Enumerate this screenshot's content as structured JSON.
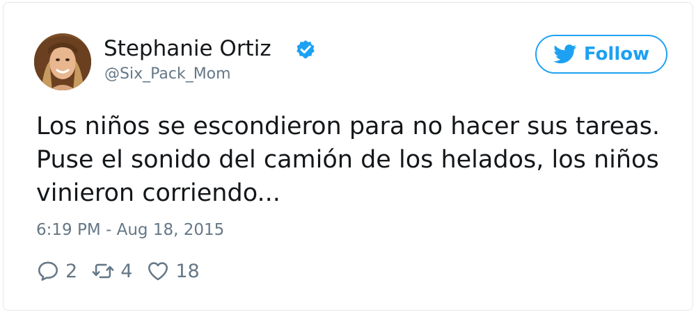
{
  "tweet": {
    "author_name": "Stephanie Ortiz",
    "author_handle": "@Six_Pack_Mom",
    "follow_label": "Follow",
    "text_lines": [
      "Los niños se escondieron para no hacer sus tareas.",
      "Puse el sonido del camión de los helados, los niños",
      "vinieron corriendo..."
    ],
    "timestamp": "6:19 PM - Aug 18, 2015",
    "reply_count": "2",
    "retweet_count": "4",
    "like_count": "18"
  },
  "colors": {
    "accent": "#1da1f2",
    "text": "#14171a",
    "muted": "#657786",
    "border": "#e1e8ed"
  },
  "icons": {
    "verified": "verified-badge-icon",
    "follow": "twitter-bird-icon",
    "reply": "reply-icon",
    "retweet": "retweet-icon",
    "like": "heart-icon"
  }
}
